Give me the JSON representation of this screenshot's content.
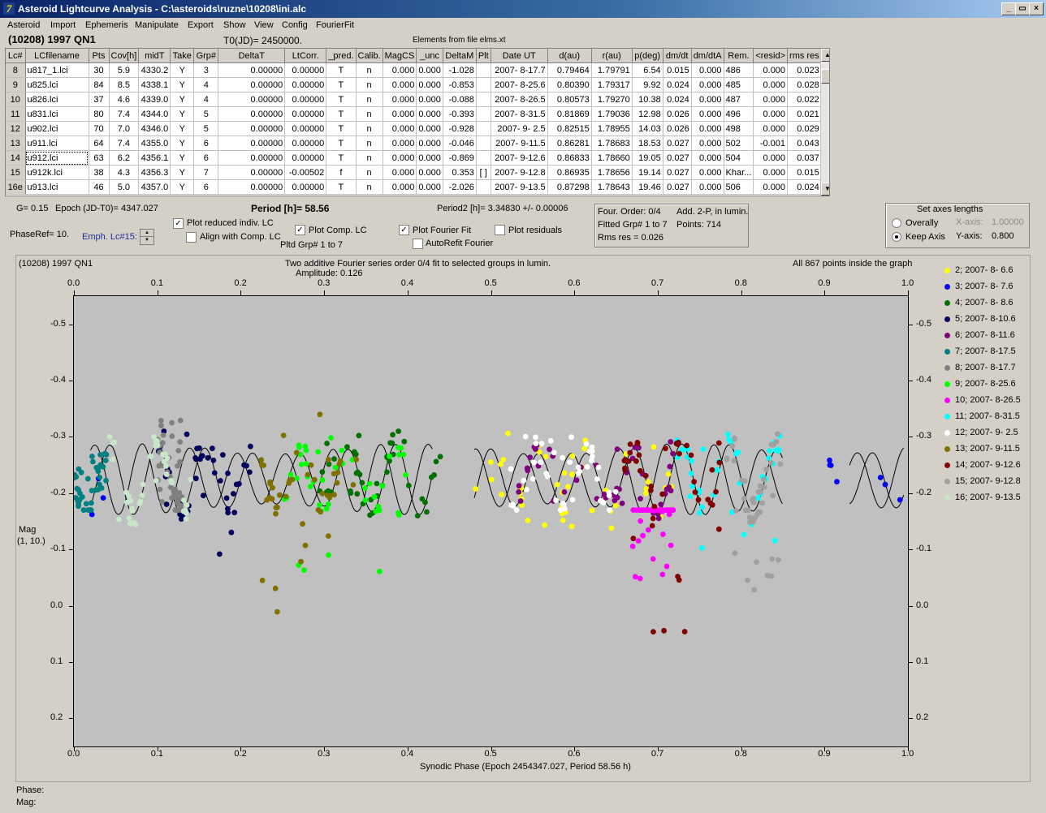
{
  "window": {
    "title": "Asteroid Lightcurve Analysis - C:\\asteroids\\ruzne\\10208\\ini.alc",
    "icon": "app-icon",
    "controls": [
      "_",
      "▭",
      "×"
    ]
  },
  "menu": [
    "Asteroid",
    "Import",
    "Ephemeris",
    "Manipulate",
    "Export",
    "Show",
    "View",
    "Config",
    "FourierFit"
  ],
  "header": {
    "asteroid": "(10208) 1997 QN1",
    "t0": "T0(JD)= 2450000.",
    "elements": "Elements from file elms.xt"
  },
  "table": {
    "columns": [
      "Lc#",
      "LCfilename",
      "Pts",
      "Cov[h]",
      "midT",
      "Take",
      "Grp#",
      "DeltaT",
      "LtCorr.",
      "_pred.",
      "Calib.",
      "MagCS",
      "_unc",
      "DeltaM",
      "Plt",
      "Date UT",
      "d(au)",
      "r(au)",
      "p(deg)",
      "dm/dt",
      "dm/dtA",
      "Rem.",
      "<resid>",
      "rms res"
    ],
    "rows": [
      [
        "8",
        "u817_1.lci",
        "30",
        "5.9",
        "4330.2",
        "Y",
        "3",
        "0.00000",
        "0.00000",
        "T",
        "n",
        "0.000",
        "0.000",
        "-1.028",
        "",
        "2007- 8-17.7",
        "0.79464",
        "1.79791",
        "6.54",
        "0.015",
        "0.000",
        "486",
        "0.000",
        "0.023"
      ],
      [
        "9",
        "u825.lci",
        "84",
        "8.5",
        "4338.1",
        "Y",
        "4",
        "0.00000",
        "0.00000",
        "T",
        "n",
        "0.000",
        "0.000",
        "-0.853",
        "",
        "2007- 8-25.6",
        "0.80390",
        "1.79317",
        "9.92",
        "0.024",
        "0.000",
        "485",
        "0.000",
        "0.028"
      ],
      [
        "10",
        "u826.lci",
        "37",
        "4.6",
        "4339.0",
        "Y",
        "4",
        "0.00000",
        "0.00000",
        "T",
        "n",
        "0.000",
        "0.000",
        "-0.088",
        "",
        "2007- 8-26.5",
        "0.80573",
        "1.79270",
        "10.38",
        "0.024",
        "0.000",
        "487",
        "0.000",
        "0.022"
      ],
      [
        "11",
        "u831.lci",
        "80",
        "7.4",
        "4344.0",
        "Y",
        "5",
        "0.00000",
        "0.00000",
        "T",
        "n",
        "0.000",
        "0.000",
        "-0.393",
        "",
        "2007- 8-31.5",
        "0.81869",
        "1.79036",
        "12.98",
        "0.026",
        "0.000",
        "496",
        "0.000",
        "0.021"
      ],
      [
        "12",
        "u902.lci",
        "70",
        "7.0",
        "4346.0",
        "Y",
        "5",
        "0.00000",
        "0.00000",
        "T",
        "n",
        "0.000",
        "0.000",
        "-0.928",
        "",
        "2007- 9- 2.5",
        "0.82515",
        "1.78955",
        "14.03",
        "0.026",
        "0.000",
        "498",
        "0.000",
        "0.029"
      ],
      [
        "13",
        "u911.lci",
        "64",
        "7.4",
        "4355.0",
        "Y",
        "6",
        "0.00000",
        "0.00000",
        "T",
        "n",
        "0.000",
        "0.000",
        "-0.046",
        "",
        "2007- 9-11.5",
        "0.86281",
        "1.78683",
        "18.53",
        "0.027",
        "0.000",
        "502",
        "-0.001",
        "0.043"
      ],
      [
        "14",
        "u912.lci",
        "63",
        "6.2",
        "4356.1",
        "Y",
        "6",
        "0.00000",
        "0.00000",
        "T",
        "n",
        "0.000",
        "0.000",
        "-0.869",
        "",
        "2007- 9-12.6",
        "0.86833",
        "1.78660",
        "19.05",
        "0.027",
        "0.000",
        "504",
        "0.000",
        "0.037"
      ],
      [
        "15",
        "u912k.lci",
        "38",
        "4.3",
        "4356.3",
        "Y",
        "7",
        "0.00000",
        "-0.00502",
        "f",
        "n",
        "0.000",
        "0.000",
        "0.353",
        "[ ]",
        "2007- 9-12.8",
        "0.86935",
        "1.78656",
        "19.14",
        "0.027",
        "0.000",
        "Khar...",
        "0.000",
        "0.015"
      ],
      [
        "16e",
        "u913.lci",
        "46",
        "5.0",
        "4357.0",
        "Y",
        "6",
        "0.00000",
        "0.00000",
        "T",
        "n",
        "0.000",
        "0.000",
        "-2.026",
        "",
        "2007- 9-13.5",
        "0.87298",
        "1.78643",
        "19.46",
        "0.027",
        "0.000",
        "506",
        "0.000",
        "0.024"
      ]
    ]
  },
  "controls": {
    "g": "G= 0.15",
    "epoch": "Epoch (JD-T0)= 4347.027",
    "period": "Period [h]= 58.56",
    "period2": "Period2 [h]= 3.34830 +/- 0.00006",
    "phaseref": "PhaseRef= 10.",
    "emph": "Emph. Lc#15:",
    "plot_reduced": "Plot reduced indiv. LC",
    "align": "Align with Comp. LC",
    "plot_comp": "Plot Comp. LC",
    "pltd_grp": "Pltd Grp#  1   to   7",
    "plot_fourier": "Plot Fourier Fit",
    "autorefit": "AutoRefit Fourier",
    "plot_resid": "Plot residuals",
    "fourier_info": {
      "order": "Four. Order:  0/4",
      "add": "Add. 2-P, in lumin.",
      "fitted": "Fitted Grp# 1 to 7",
      "points": "Points: 714",
      "rms": "Rms res      = 0.026"
    },
    "axes": {
      "title": "Set axes lengths",
      "overally": "Overally",
      "keep": "Keep Axis",
      "xaxis_lbl": "X-axis:",
      "xaxis_val": "1.00000",
      "yaxis_lbl": "Y-axis:",
      "yaxis_val": "0.800"
    }
  },
  "plot": {
    "name": "(10208) 1997 QN1",
    "subtitle1": "Two additive Fourier series order 0/4 fit to selected groups in lumin.",
    "subtitle2": "Amplitude: 0.126",
    "inside": "All 867 points inside the graph",
    "ylabel1": "Mag",
    "ylabel2": "(1, 10.)",
    "xlabel": "Synodic Phase (Epoch 2454347.027, Period 58.56 h)"
  },
  "status": {
    "phase": "Phase:",
    "mag": "Mag:"
  },
  "chart_data": {
    "type": "scatter",
    "xlabel": "Synodic Phase (Epoch 2454347.027, Period 58.56 h)",
    "ylabel": "Mag",
    "xlim": [
      0,
      1
    ],
    "ylim": [
      -0.55,
      0.25
    ],
    "y_inverted": true,
    "xticks": [
      "0.0",
      "0.1",
      "0.2",
      "0.3",
      "0.4",
      "0.5",
      "0.6",
      "0.7",
      "0.8",
      "0.9",
      "1.0"
    ],
    "yticks": [
      "-0.5",
      "-0.4",
      "-0.3",
      "-0.2",
      "-0.1",
      "0.0",
      "0.1",
      "0.2"
    ],
    "fourier_fit": {
      "mean": -0.225,
      "amplitude": 0.063,
      "cycles": 17.5
    },
    "series": [
      {
        "name": "2; 2007- 8- 6.6",
        "color": "#ffff00",
        "x_range": [
          0.48,
          0.72
        ],
        "y_range": [
          -0.31,
          -0.13
        ]
      },
      {
        "name": "3; 2007- 8- 7.6",
        "color": "#0000ff",
        "x_range": [
          0.0,
          1.0
        ],
        "y_range": [
          -0.31,
          -0.13
        ]
      },
      {
        "name": "4; 2007- 8- 8.6",
        "color": "#007000",
        "x_range": [
          0.29,
          0.44
        ],
        "y_range": [
          -0.31,
          -0.16
        ]
      },
      {
        "name": "5; 2007- 8-10.6",
        "color": "#00005a",
        "x_range": [
          0.1,
          0.22
        ],
        "y_range": [
          -0.31,
          -0.08
        ]
      },
      {
        "name": "6; 2007- 8-11.6",
        "color": "#800080",
        "x_range": [
          0.52,
          0.72
        ],
        "y_range": [
          -0.3,
          -0.15
        ]
      },
      {
        "name": "7; 2007- 8-17.5",
        "color": "#008080",
        "x_range": [
          0.0,
          0.04
        ],
        "y_range": [
          -0.27,
          -0.17
        ]
      },
      {
        "name": "8; 2007- 8-17.7",
        "color": "#808080",
        "x_range": [
          0.1,
          0.13
        ],
        "y_range": [
          -0.33,
          -0.17
        ]
      },
      {
        "name": "9; 2007- 8-25.6",
        "color": "#00ff00",
        "x_range": [
          0.25,
          0.4
        ],
        "y_range": [
          -0.31,
          -0.0
        ]
      },
      {
        "name": "10; 2007- 8-26.5",
        "color": "#ff00ff",
        "x_range": [
          0.67,
          0.72
        ],
        "y_range": [
          -0.17,
          -0.04
        ]
      },
      {
        "name": "11; 2007- 8-31.5",
        "color": "#00ffff",
        "x_range": [
          0.72,
          0.85
        ],
        "y_range": [
          -0.32,
          -0.04
        ]
      },
      {
        "name": "12; 2007- 9- 2.5",
        "color": "#ffffff",
        "x_range": [
          0.52,
          0.65
        ],
        "y_range": [
          -0.31,
          -0.17
        ]
      },
      {
        "name": "13; 2007- 9-11.5",
        "color": "#807000",
        "x_range": [
          0.22,
          0.34
        ],
        "y_range": [
          -0.34,
          0.05
        ]
      },
      {
        "name": "14; 2007- 9-12.6",
        "color": "#800000",
        "x_range": [
          0.66,
          0.78
        ],
        "y_range": [
          -0.29,
          0.05
        ]
      },
      {
        "name": "15; 2007- 9-12.8",
        "color": "#a0a0a0",
        "x_range": [
          0.78,
          0.85
        ],
        "y_range": [
          -0.31,
          -0.02
        ]
      },
      {
        "name": "16; 2007- 9-13.5",
        "color": "#c8e6c8",
        "x_range": [
          0.04,
          0.14
        ],
        "y_range": [
          -0.3,
          -0.13
        ]
      }
    ]
  }
}
